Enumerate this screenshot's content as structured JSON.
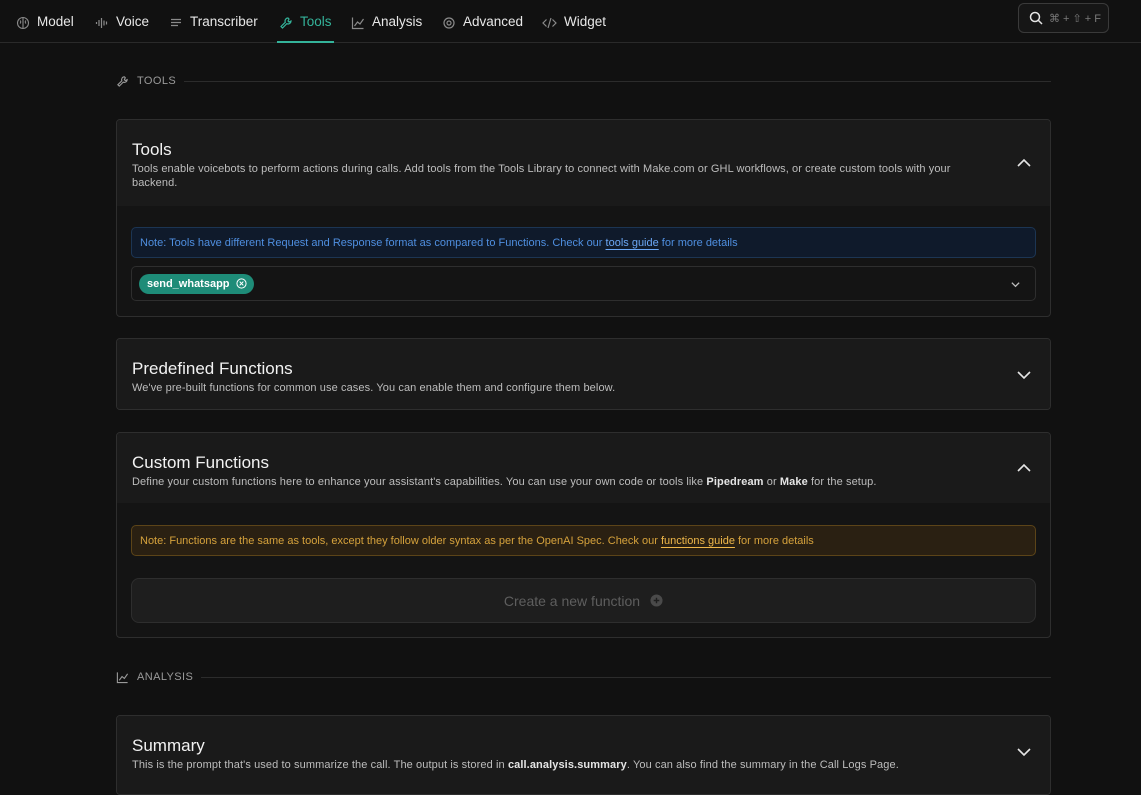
{
  "tabs": [
    {
      "label": "Model",
      "icon": "brain-icon",
      "active": false
    },
    {
      "label": "Voice",
      "icon": "audio-wave-icon",
      "active": false
    },
    {
      "label": "Transcriber",
      "icon": "text-lines-icon",
      "active": false
    },
    {
      "label": "Tools",
      "icon": "wrench-icon",
      "active": true
    },
    {
      "label": "Analysis",
      "icon": "line-chart-icon",
      "active": false
    },
    {
      "label": "Advanced",
      "icon": "gear-icon",
      "active": false
    },
    {
      "label": "Widget",
      "icon": "code-icon",
      "active": false
    }
  ],
  "search": {
    "shortcut": "⌘ + ⇧ + F",
    "icon": "search-icon"
  },
  "sections": {
    "tools_header": "TOOLS",
    "analysis_header": "ANALYSIS"
  },
  "tools_card": {
    "title": "Tools",
    "description": "Tools enable voicebots to perform actions during calls. Add tools from the Tools Library to connect with Make.com or GHL workflows, or create custom tools with your backend.",
    "note_prefix": "Note: Tools have different Request and Response format as compared to Functions. Check our ",
    "note_link": "tools guide",
    "note_suffix": " for more details",
    "selected_tools": [
      "send_whatsapp"
    ],
    "expanded": true
  },
  "predefined_card": {
    "title": "Predefined Functions",
    "description": "We've pre-built functions for common use cases. You can enable them and configure them below.",
    "expanded": false
  },
  "custom_card": {
    "title": "Custom Functions",
    "desc_part1": "Define your custom functions here to enhance your assistant's capabilities. You can use your own code or tools like ",
    "desc_bold1": "Pipedream",
    "desc_part2": " or ",
    "desc_bold2": "Make",
    "desc_part3": " for the setup.",
    "note_prefix": "Note: Functions are the same as tools, except they follow older syntax as per the OpenAI Spec. Check our ",
    "note_link": "functions guide",
    "note_suffix": " for more details",
    "create_label": "Create a new function",
    "expanded": true
  },
  "summary_card": {
    "title": "Summary",
    "desc_part1": "This is the prompt that's used to summarize the call. The output is stored in ",
    "desc_bold": "call.analysis.summary",
    "desc_part2": ". You can also find the summary in the Call Logs Page.",
    "expanded": false
  },
  "colors": {
    "accent": "#34b39a",
    "chip": "#1e8c78",
    "info_blue": "#4f8fe0",
    "warning_amber": "#d6a23c",
    "background": "#111111"
  }
}
